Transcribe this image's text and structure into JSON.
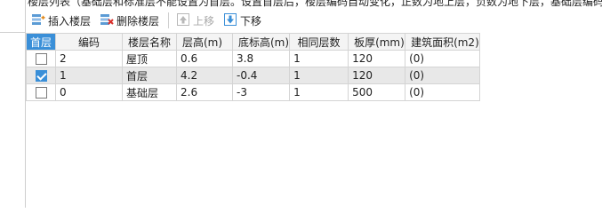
{
  "info_text": "楼层列表（基础层和标准层不能设置为首层。设置首层后，楼层编码自动变化，正数为地上层，负数为地下层，基础层编码",
  "toolbar": {
    "insert_label": "插入楼层",
    "delete_label": "删除楼层",
    "up_label": "上移",
    "down_label": "下移"
  },
  "table": {
    "headers": [
      "首层",
      "编码",
      "楼层名称",
      "层高(m)",
      "底标高(m)",
      "相同层数",
      "板厚(mm)",
      "建筑面积(m2)"
    ],
    "rows": [
      {
        "checked": false,
        "code": "2",
        "name": "屋顶",
        "height": "0.6",
        "elev": "3.8",
        "same": "1",
        "slab": "120",
        "area": "(0)"
      },
      {
        "checked": true,
        "code": "1",
        "name": "首层",
        "height": "4.2",
        "elev": "-0.4",
        "same": "1",
        "slab": "120",
        "area": "(0)"
      },
      {
        "checked": false,
        "code": "0",
        "name": "基础层",
        "height": "2.6",
        "elev": "-3",
        "same": "1",
        "slab": "500",
        "area": "(0)"
      }
    ]
  },
  "colors": {
    "accent": "#3a8fd8",
    "selected_row": "#e8e8e8",
    "header_bg": "#f4f4f4"
  }
}
